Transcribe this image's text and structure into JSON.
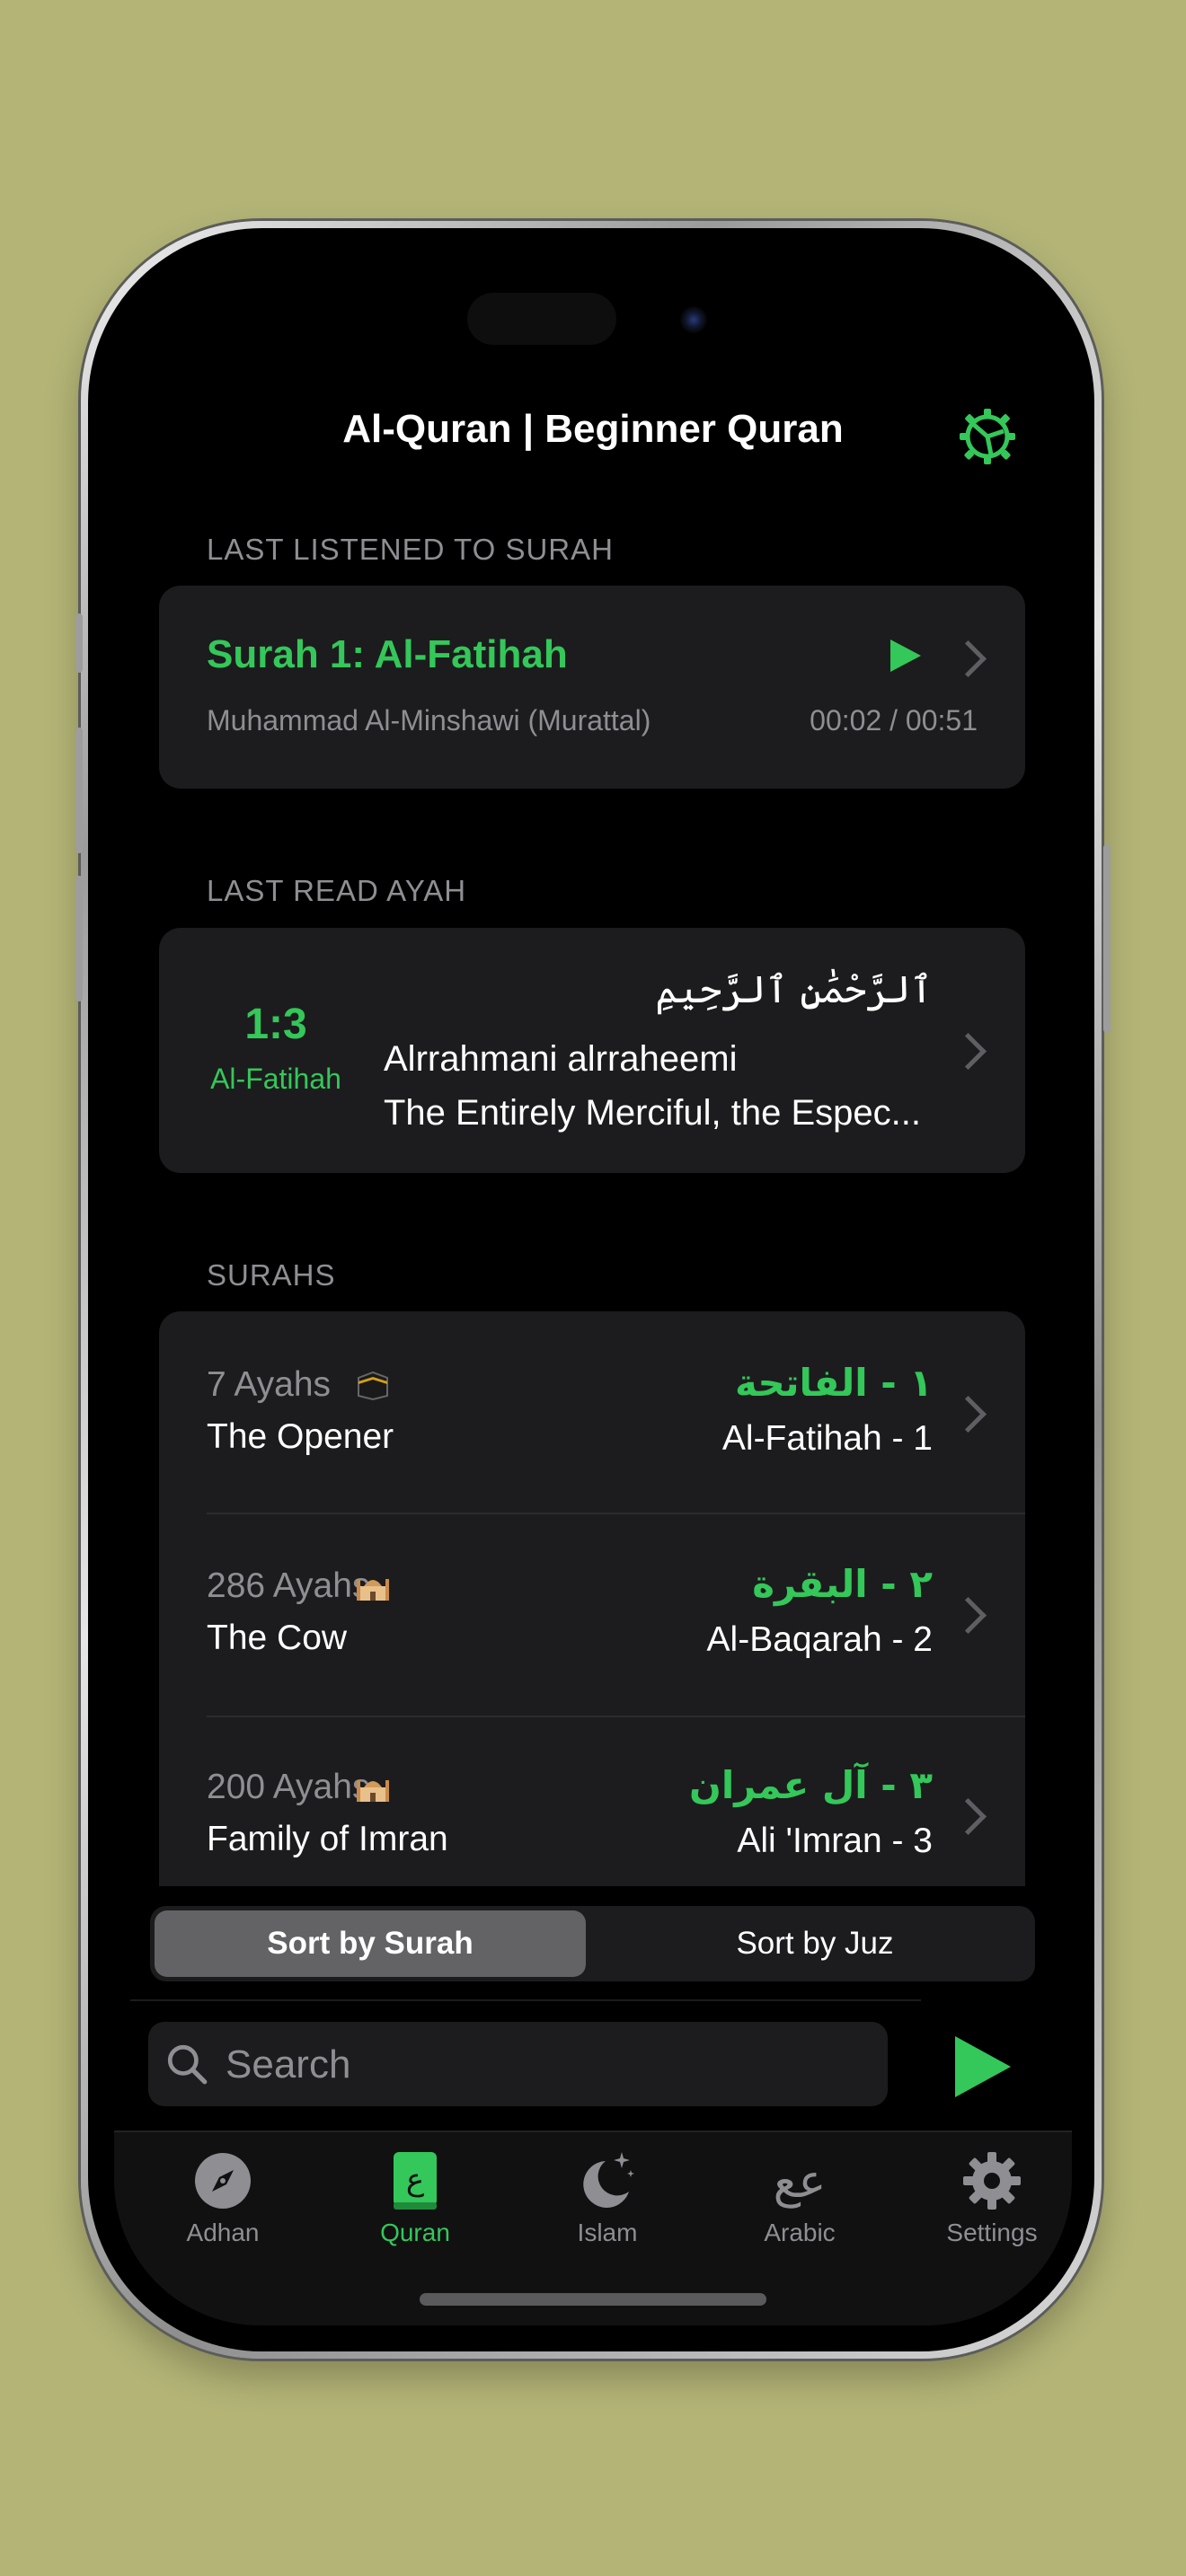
{
  "app": {
    "title": "Al-Quran | Beginner Quran"
  },
  "last_listened": {
    "section_label": "LAST LISTENED TO SURAH",
    "surah_title": "Surah 1: Al-Fatihah",
    "reciter": "Muhammad Al-Minshawi (Murattal)",
    "progress_time": "00:02 / 00:51"
  },
  "last_read": {
    "section_label": "LAST READ AYAH",
    "ayah_ref": "1:3",
    "surah_name": "Al-Fatihah",
    "arabic": "ٱلرَّحْمَٰنِ ٱلرَّحِيمِ",
    "transliteration": "Alrrahmani alrraheemi",
    "translation": "The Entirely Merciful, the Espec..."
  },
  "surahs": {
    "section_label": "SURAHS",
    "items": [
      {
        "ayahs": "7 Ayahs",
        "english": "The Opener",
        "arabic": "١ - الفاتحة",
        "transliteration": "Al-Fatihah - 1",
        "place_icon": "kaaba-icon"
      },
      {
        "ayahs": "286 Ayahs",
        "english": "The Cow",
        "arabic": "٢ - البقرة",
        "transliteration": "Al-Baqarah - 2",
        "place_icon": "mosque-icon"
      },
      {
        "ayahs": "200 Ayahs",
        "english": "Family of Imran",
        "arabic": "٣ - آل عمران",
        "transliteration": "Ali 'Imran - 3",
        "place_icon": "mosque-icon"
      }
    ]
  },
  "sort": {
    "by_surah": "Sort by Surah",
    "by_juz": "Sort by Juz",
    "selected": "Sort by Surah"
  },
  "search": {
    "placeholder": "Search",
    "value": ""
  },
  "tabs": [
    {
      "label": "Adhan",
      "icon": "compass-icon",
      "active": false
    },
    {
      "label": "Quran",
      "icon": "quran-book-icon",
      "active": true
    },
    {
      "label": "Islam",
      "icon": "moon-stars-icon",
      "active": false
    },
    {
      "label": "Arabic",
      "icon": "arabic-letters-icon",
      "active": false
    },
    {
      "label": "Settings",
      "icon": "gear-icon",
      "active": false
    }
  ],
  "colors": {
    "accent": "#34c759",
    "background": "#000000",
    "card": "#1c1c1e",
    "secondary_text": "#8e8e93",
    "backdrop": "#b3b476"
  }
}
